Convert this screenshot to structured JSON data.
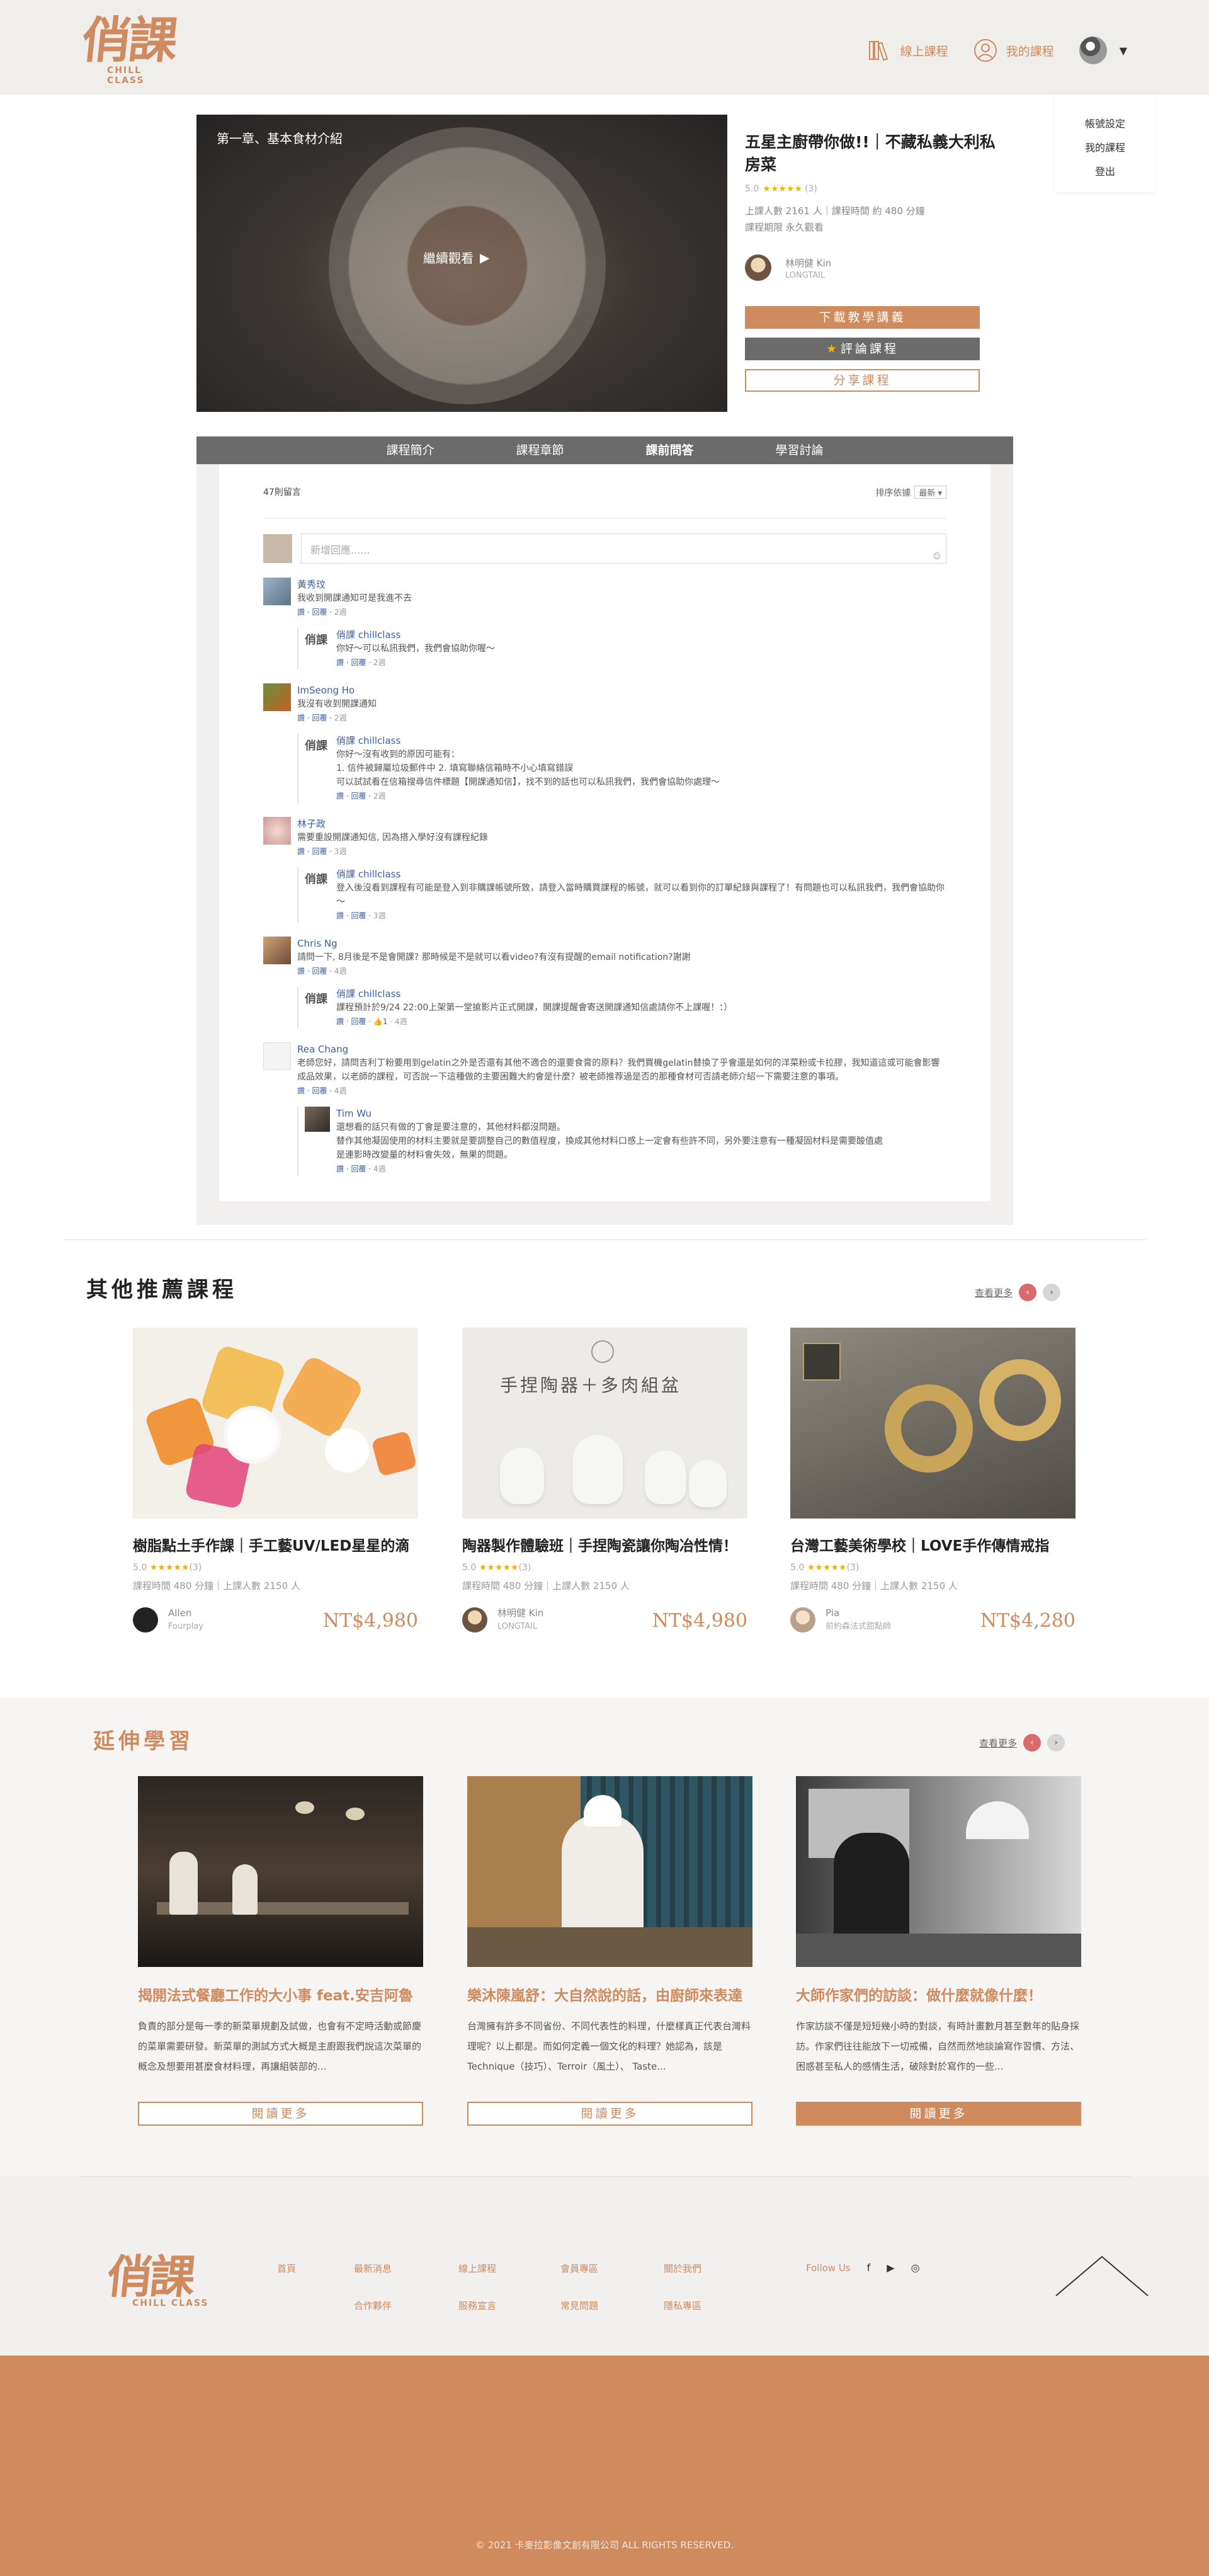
{
  "header": {
    "logo_main": "俏課",
    "logo_sub": "CHILL CLASS",
    "nav_online": "線上課程",
    "nav_my": "我的課程"
  },
  "user_menu": {
    "items": [
      "帳號設定",
      "我的課程",
      "登出"
    ]
  },
  "video": {
    "chapter": "第一章、基本食材介紹",
    "play_label": "繼續觀看"
  },
  "course": {
    "title": "五星主廚帶你做!!｜不藏私義大利私房菜",
    "rating_text": "5.0",
    "stars": "★★★★★",
    "rating_count": "(3)",
    "meta1": "上課人數 2161 人｜課程時間 約 480 分鐘",
    "meta2": "課程期限 永久觀看",
    "teacher_name": "林明健 Kin",
    "teacher_sub": "LONGTAIL",
    "btn_download": "下載教學講義",
    "btn_evaluate": "評論課程",
    "btn_share": "分享課程"
  },
  "tabs": [
    "課程簡介",
    "課程章節",
    "課前問答",
    "學習討論"
  ],
  "qa": {
    "count": "47則留言",
    "sort_label": "排序依據",
    "sort_value": "最新 ▾",
    "input_placeholder": "新增回應......",
    "comments": [
      {
        "name": "黃秀玟",
        "text": "我收到開課通知可是我進不去",
        "actions": "讚 · 回覆 · ",
        "time": "2週",
        "reply": {
          "name": "俏課 chillclass",
          "text": "你好～可以私訊我們，我們會協助你喔～",
          "actions": "讚 · 回覆 · ",
          "time": "2週"
        }
      },
      {
        "name": "ImSeong Ho",
        "text": "我沒有收到開課通知",
        "actions": "讚 · 回覆 · ",
        "time": "2週",
        "reply": {
          "name": "俏課 chillclass",
          "text": "你好～沒有收到的原因可能有：",
          "text2": "1. 信件被歸屬垃圾郵件中 2. 填寫聯絡信箱時不小心填寫錯誤",
          "text3": "可以試試看在信箱搜尋信件標題【開課通知信】，找不到的話也可以私訊我們，我們會協助你處理～",
          "actions": "讚 · 回覆 · ",
          "time": "2週"
        }
      },
      {
        "name": "林子政",
        "text": "需要重設開課通知信, 因為搭入學好沒有課程紀錄",
        "actions": "讚 · 回覆 · ",
        "time": "3週",
        "reply": {
          "name": "俏課 chillclass",
          "text": "登入後沒看到課程有可能是登入到非購課帳號所致，請登入當時購買課程的帳號，就可以看到你的訂單紀錄與課程了！有問題也可以私訊我們，我們會協助你～",
          "actions": "讚 · 回覆 · ",
          "time": "3週"
        }
      },
      {
        "name": "Chris Ng",
        "text": "請問一下, 8月後是不是會開課? 那時候是不是就可以看video?有沒有提醒的email notification?謝謝",
        "actions": "讚 · 回覆 · ",
        "time": "4週",
        "reply": {
          "name": "俏課 chillclass",
          "text": "課程預計於9/24 22:00上架第一堂搶影片正式開課，開課提醒會寄送開課通知信處請你不上課喔！：）",
          "actions": "讚 · 回覆 · ",
          "likes": "1",
          "time": "4週"
        }
      },
      {
        "name": "Rea Chang",
        "text": "老師您好，請問吉利丁粉要用到gelatin之外是否還有其他不適合的還要食膏的原料？我們買機gelatin替換了乎會還是如何的洋菜粉或卡拉膠，我知道這或可能會影響成品效果，以老師的課程，可否說一下這種做的主要困難大約會是什麼？被老師推荐過是否的那種食材可否請老師介紹一下需要注意的事項。",
        "actions": "讚 · 回覆 · ",
        "time": "4週",
        "reply": {
          "name": "Tim Wu",
          "text": "還想看的話只有做的丁會是要注意的，其他材料都沒問題。",
          "text2": "替作其他凝固使用的材料主要就是要調整自己的數值程度，換成其他材料口感上一定會有些許不同，另外要注意有一種凝固材料是需要酸值處",
          "text3": "是連影時改變量的材料會失效，無果的問題。",
          "actions": "讚 · 回覆 · ",
          "time": "4週"
        }
      }
    ]
  },
  "recommend": {
    "title": "其他推薦課程",
    "more": "查看更多",
    "cards": [
      {
        "title": "樹脂點土手作課｜手工藝UV/LED星星的滴",
        "stars": "★★★★★",
        "rating": "5.0",
        "count": "(3)",
        "meta": "課程時間 480 分鐘｜上課人數 2150 人",
        "teacher": "Allen",
        "teacher_sub": "Fourplay",
        "price": "NT$4,980"
      },
      {
        "title": "陶器製作體驗班｜手捏陶瓷讓你陶冶性情！",
        "stars": "★★★★★",
        "rating": "5.0",
        "count": "(3)",
        "meta": "課程時間 480 分鐘｜上課人數 2150 人",
        "teacher": "林明健 Kin",
        "teacher_sub": "LONGTAIL",
        "price": "NT$4,980",
        "img_text": "手捏陶器＋多肉組盆"
      },
      {
        "title": "台灣工藝美術學校｜LOVE手作傳情戒指",
        "stars": "★★★★★",
        "rating": "5.0",
        "count": "(3)",
        "meta": "課程時間 480 分鐘｜上課人數 2150 人",
        "teacher": "Pia",
        "teacher_sub": "前約森法式甜點師",
        "price": "NT$4,280"
      }
    ]
  },
  "extend": {
    "title": "延伸學習",
    "more": "查看更多",
    "cards": [
      {
        "title": "揭開法式餐廳工作的大小事 feat.安吉阿魯",
        "desc": "負責的部分是每一季的新菜單規劃及試做，也會有不定時活動或節慶的菜單需要研發。新菜單的測試方式大概是主廚跟我們說這次菜單的概念及想要用甚麼食材料理，再讓組裝部的...",
        "btn": "閱讀更多"
      },
      {
        "title": "樂沐陳嵐舒：大自然說的話，由廚師來表達",
        "desc": "台灣擁有許多不同省份、不同代表性的料理，什麼樣真正代表台灣料理呢？以上都是。而如何定義一個文化的料理？她認為，該是Technique（技巧）、Terroir（風土）、 Taste...",
        "btn": "閱讀更多"
      },
      {
        "title": "大師作家們的訪談：做什麼就像什麼！",
        "desc": "作家訪談不僅是短短幾小時的對談，有時計畫數月甚至數年的貼身採訪。作家們往往能放下一切戒備，自然而然地談論寫作習慣、方法、困惑甚至私人的感情生活，破除對於寫作的一些...",
        "btn": "閱讀更多"
      }
    ]
  },
  "footer": {
    "links": [
      "首頁",
      "最新消息",
      "線上課程",
      "會員專區",
      "關於我們",
      "",
      "合作夥伴",
      "服務宣言",
      "常見問題",
      "隱私專區"
    ],
    "follow": "Follow Us",
    "social": [
      "f",
      "▶",
      "◎"
    ],
    "copyright": "© 2021 卡麥拉影像文創有限公司 ALL RIGHTS RESERVED."
  }
}
